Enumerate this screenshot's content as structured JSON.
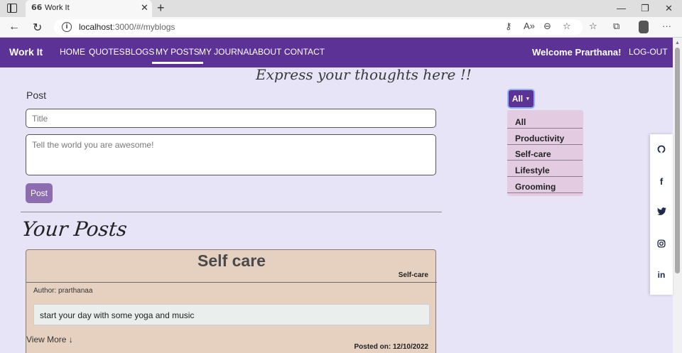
{
  "browser": {
    "tab_title": "Work It",
    "favicon": "66",
    "url_host": "localhost",
    "url_path": ":3000/#/myblogs"
  },
  "navbar": {
    "brand": "Work It",
    "links": [
      "HOME",
      "QUOTES",
      "BLOGS",
      "MY POSTS",
      "MY JOURNAL",
      "ABOUT",
      "CONTACT"
    ],
    "active_link": "MY POSTS",
    "welcome": "Welcome Prarthana!",
    "logout": "LOG-OUT"
  },
  "composer": {
    "tagline": "Express your thoughts here !!",
    "label": "Post",
    "title_placeholder": "Title",
    "body_placeholder": "Tell the world you are awesome!",
    "submit_label": "Post"
  },
  "posts_section": {
    "heading": "Your Posts",
    "posts": [
      {
        "title": "Self care",
        "category": "Self-care",
        "author": "Author: prarthanaa",
        "body": "start your day with some yoga and music",
        "view_more": "View More ↓",
        "posted_on": "Posted on: 12/10/2022"
      }
    ]
  },
  "filter": {
    "selected": "All",
    "options": [
      "All",
      "Productivity",
      "Self-care",
      "Lifestyle",
      "Grooming"
    ]
  },
  "social": [
    "github-icon",
    "facebook-icon",
    "twitter-icon",
    "instagram-icon",
    "linkedin-icon"
  ],
  "colors": {
    "accent": "#5c3296",
    "page_bg": "#e7e4f8",
    "card_bg": "#e6d1c1",
    "menu_bg": "#e3cbe2",
    "post_button": "#8d6cb0"
  }
}
